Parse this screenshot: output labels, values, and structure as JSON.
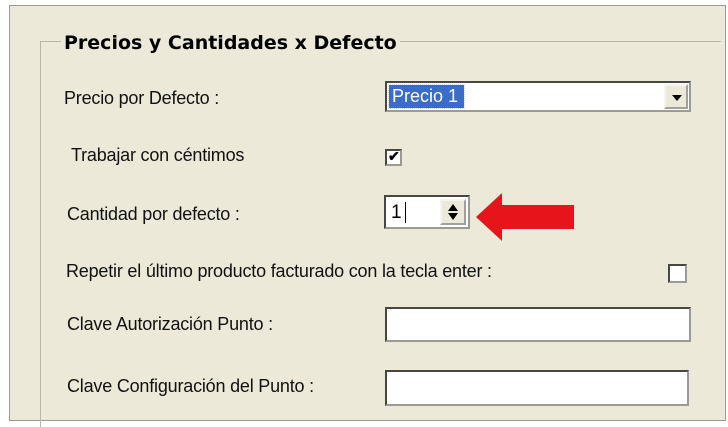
{
  "group": {
    "title": "Precios y Cantidades x Defecto"
  },
  "fields": {
    "precio_defecto": {
      "label": "Precio por Defecto :",
      "value": "Precio 1"
    },
    "trabajar_centimos": {
      "label": "Trabajar con céntimos",
      "checked": true,
      "mark": "✔"
    },
    "cantidad_defecto": {
      "label": "Cantidad por defecto :",
      "value": "1"
    },
    "repetir_producto": {
      "label": "Repetir el último producto facturado con la tecla enter :",
      "checked": false
    },
    "clave_autorizacion": {
      "label": "Clave Autorización Punto :",
      "value": ""
    },
    "clave_configuracion": {
      "label": "Clave Configuración del  Punto :",
      "value": ""
    }
  },
  "annotation": {
    "arrow_color": "#e8141b",
    "arrow_icon": "left-arrow-icon"
  },
  "colors": {
    "dialog_bg": "#ece9d8",
    "selection": "#3a6cc9"
  }
}
